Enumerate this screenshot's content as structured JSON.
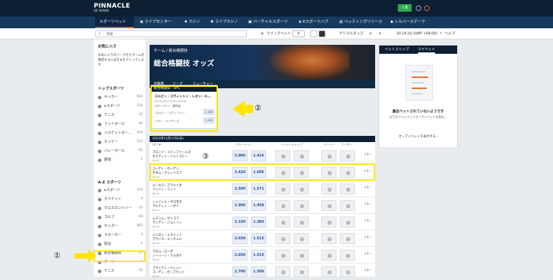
{
  "brand": {
    "name": "PINNACLE",
    "sub": "25 YEARS",
    "deposit": "入金"
  },
  "nav": {
    "items": [
      "スポーツベット",
      "ライブセンター",
      "カジノ",
      "ライブカジノ",
      "バーチャルスポーツ",
      "Eスポーツハブ",
      "ベッティングリソース",
      "シルバースデーク"
    ]
  },
  "toolbar": {
    "search_placeholder": "検索",
    "quickbet": "クイックベット",
    "quickbet_value": "0",
    "odds_format": "デシマルオッズ",
    "time": "20:14:22 (GMT +09:00)",
    "help": "ヘルプ"
  },
  "sidebar": {
    "fav_title": "お気に入り",
    "fav_text": "お気に入りのリーグをたチームを確認するにはを★をクリックします",
    "top_title": "トップスポーツ",
    "top": [
      {
        "name": "サッカー",
        "count": "963"
      },
      {
        "name": "eスポーツ",
        "count": "118"
      },
      {
        "name": "テニス",
        "count": "25"
      },
      {
        "name": "フットボール",
        "count": "69"
      },
      {
        "name": "バスケットボー...",
        "count": "263"
      },
      {
        "name": "ホッケー",
        "count": "137"
      },
      {
        "name": "バレーボール",
        "count": "65"
      },
      {
        "name": "野球",
        "count": "1"
      }
    ],
    "az_title": "A-Z スポーツ",
    "az": [
      {
        "name": "eスポーツ",
        "count": "118"
      },
      {
        "name": "クリケット",
        "count": "9"
      },
      {
        "name": "クロスカントリー",
        "count": "15"
      },
      {
        "name": "ゴルフ",
        "count": "69"
      },
      {
        "name": "サッカー",
        "count": "963"
      },
      {
        "name": "スヌーカー",
        "count": "3"
      },
      {
        "name": "政治",
        "count": "1"
      },
      {
        "name": "総合格闘技",
        "count": "21"
      },
      {
        "name": "ダーツ",
        "count": "1"
      },
      {
        "name": "テニス",
        "count": "25"
      }
    ]
  },
  "hero": {
    "breadcrumb": "ホーム / 総合格闘技",
    "title": "総合格闘技 オッズ"
  },
  "tabs": [
    "対戦表",
    "リーグ",
    "フューチャー"
  ],
  "card": {
    "header": "総合格闘技 - UFC",
    "match": "コルビー・コヴィントン - レオン・エ...",
    "date": "2023/12/17 0:00 (10:00)",
    "market": "マネーライン - 勝利者",
    "p1": "コルビー・コヴィントン",
    "o1": "2.360",
    "p2": "レオン・エドワーズ",
    "o2": "1.641"
  },
  "annotations": {
    "a1": "①",
    "a2": "②",
    "a3": "③"
  },
  "table": {
    "date": "2023年12月17日(日)",
    "cols": [
      "UFC ▼",
      "マネーライン",
      "ハンディキャップ",
      "オーバー",
      "アンダー"
    ],
    "rows": [
      {
        "p1": "ブロンゾ・メフィファール子",
        "p2": "ダスティン・ジェイコビー",
        "time": "08:15",
        "o1": "3.000",
        "o2": "1.416"
      },
      {
        "p1": "コーディ・ガーデン",
        "p2": "サダム・ヴェンヘスフ",
        "time": "08:15",
        "o1": "2.420",
        "o2": "1.606"
      },
      {
        "p1": "ルーカス・アラメイダ",
        "p2": "アンドレ・フィリ",
        "time": "08:15",
        "o1": "2.500",
        "o2": "1.571"
      },
      {
        "p1": "シャイレル・ギロ宝子",
        "p2": "マルティン・ノダイ",
        "time": "08:15",
        "o1": "2.900",
        "o2": "1.458"
      },
      {
        "p1": "ムスリム・サリコフ",
        "p2": "ランディ・ジョンソン",
        "time": "08:15",
        "o1": "3.150",
        "o2": "1.384"
      },
      {
        "p1": "ジャロシ・ミズメット",
        "p2": "プライス・ミッチェル",
        "time": "08:15",
        "o1": "2.650",
        "o2": "1.515"
      },
      {
        "p1": "マロル・ローザ",
        "p2": "ノーリーン・アルダナ",
        "time": "08:15",
        "o1": "2.650",
        "o2": "1.515"
      },
      {
        "p1": "ブライアン・ケレハー",
        "p2": "コーディ・ガーブランド",
        "time": "08:15",
        "o1": "2.700",
        "o2": "1.500"
      }
    ],
    "more": "+1 ›"
  },
  "slip": {
    "tab1": "ベットスリップ",
    "tab2": "マイベット",
    "empty_title": "最近ベットされていないようです",
    "empty_text": "以下をクリックしてオープンベットを表示。",
    "link": "オープンベットを表示する ›"
  }
}
